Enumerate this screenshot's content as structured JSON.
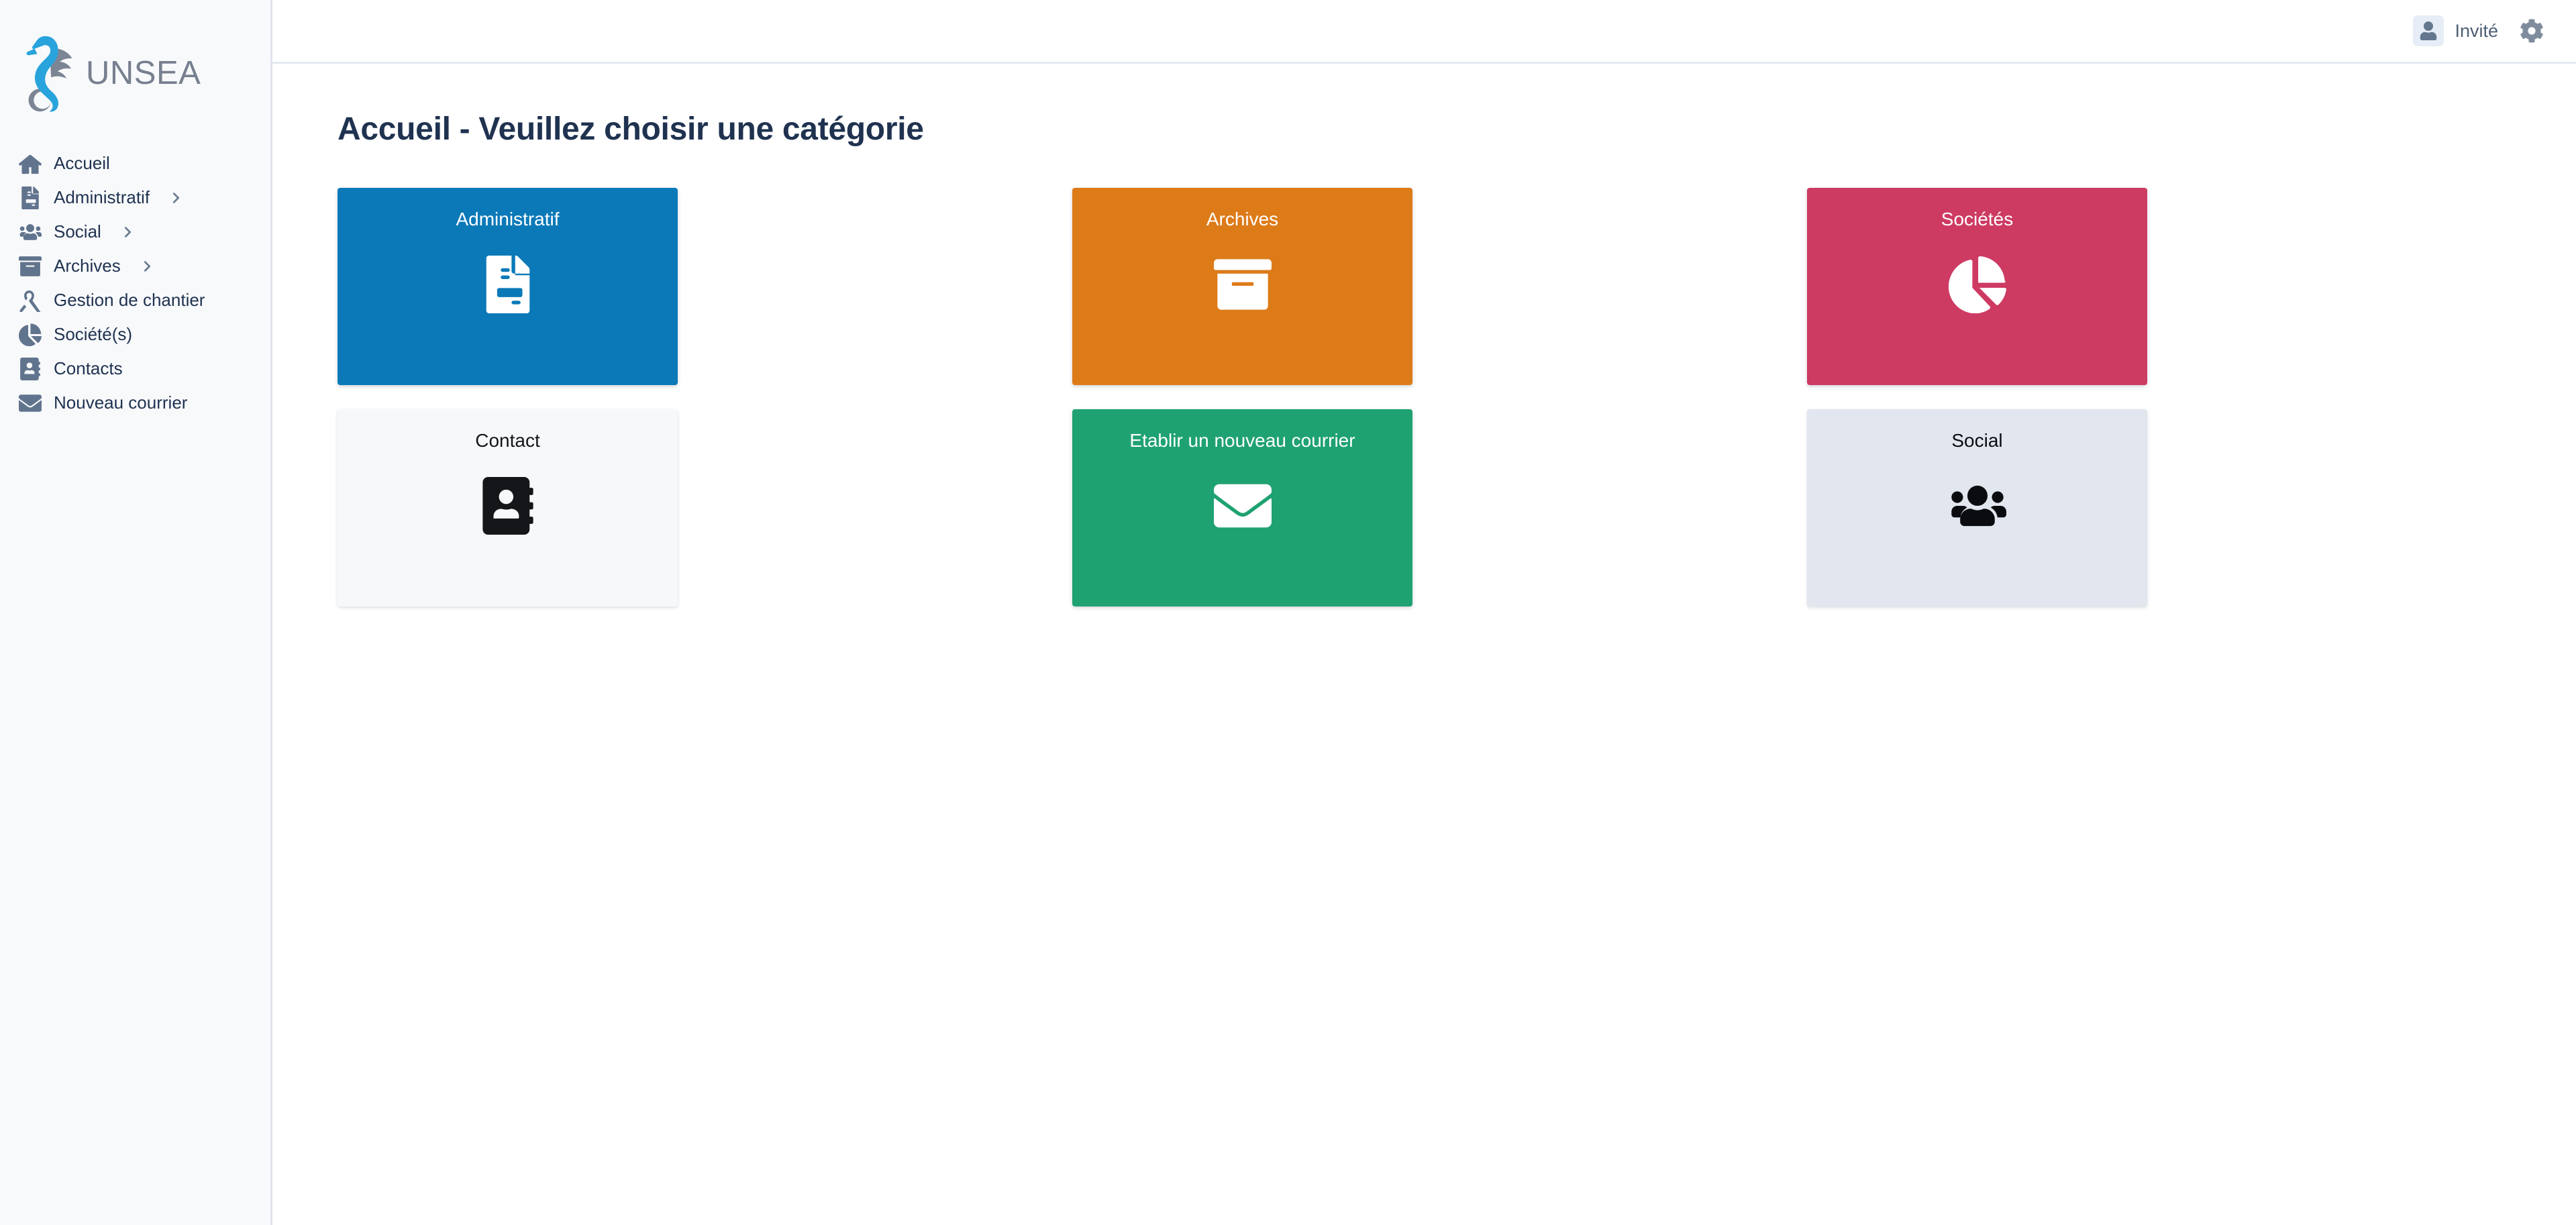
{
  "brand": {
    "name": "UNSEA",
    "logo_icon": "seahorse-logo-icon",
    "logo_primary_color": "#29a3dc",
    "logo_secondary_color": "#7c8594",
    "wordmark_color": "#77808f"
  },
  "topbar": {
    "user_label": "Invité",
    "user_icon": "person-icon",
    "settings_icon": "gear-icon"
  },
  "sidebar": {
    "items": [
      {
        "label": "Accueil",
        "icon": "home-icon",
        "has_chevron": false
      },
      {
        "label": "Administratif",
        "icon": "file-lines-icon",
        "has_chevron": true
      },
      {
        "label": "Social",
        "icon": "users-icon",
        "has_chevron": true
      },
      {
        "label": "Archives",
        "icon": "archive-box-icon",
        "has_chevron": true
      },
      {
        "label": "Gestion de chantier",
        "icon": "compass-drafting-icon",
        "has_chevron": false
      },
      {
        "label": "Société(s)",
        "icon": "pie-chart-icon",
        "has_chevron": false
      },
      {
        "label": "Contacts",
        "icon": "address-book-icon",
        "has_chevron": false
      },
      {
        "label": "Nouveau courrier",
        "icon": "envelope-icon",
        "has_chevron": false
      }
    ]
  },
  "main": {
    "page_title": "Accueil - Veuillez choisir une catégorie",
    "tiles": [
      {
        "label": "Administratif",
        "icon": "file-lines-icon",
        "bg": "#0b79b8",
        "fg": "#ffffff"
      },
      {
        "label": "Archives",
        "icon": "archive-box-icon",
        "bg": "#dd7b19",
        "fg": "#ffffff"
      },
      {
        "label": "Sociétés",
        "icon": "pie-chart-icon",
        "bg": "#cd3a62",
        "fg": "#ffffff"
      },
      {
        "label": "Contact",
        "icon": "address-book-icon",
        "bg": "#f6f8fa",
        "fg": "#15161a"
      },
      {
        "label": "Etablir un nouveau courrier",
        "icon": "envelope-icon",
        "bg": "#1fa271",
        "fg": "#ffffff"
      },
      {
        "label": "Social",
        "icon": "users-icon",
        "bg": "#e1e6ef",
        "fg": "#0b0c0f"
      }
    ]
  },
  "theme": {
    "sidebar_bg": "#f8f9fb",
    "sidebar_border": "#dfe3ec",
    "header_border": "#e4e8f0",
    "text_dark": "#1f3250",
    "icon_muted": "#61748e",
    "page_bg": "#ffffff"
  }
}
